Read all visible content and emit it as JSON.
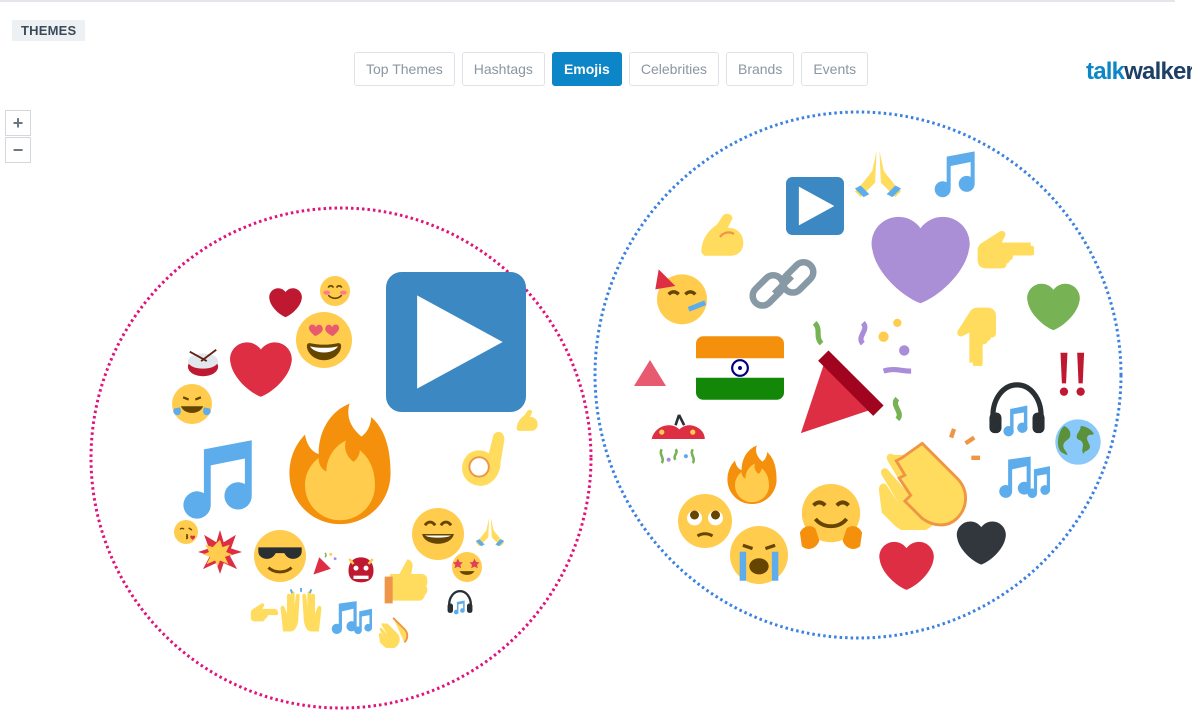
{
  "header": {
    "section_label": "THEMES",
    "brand": {
      "part1": "talk",
      "part2": "walker",
      "color1": "#0c86c6",
      "color2": "#1e3f66"
    }
  },
  "tabs": [
    {
      "label": "Top Themes",
      "active": false
    },
    {
      "label": "Hashtags",
      "active": false
    },
    {
      "label": "Emojis",
      "active": true
    },
    {
      "label": "Celebrities",
      "active": false
    },
    {
      "label": "Brands",
      "active": false
    },
    {
      "label": "Events",
      "active": false
    }
  ],
  "zoom": {
    "in_label": "+",
    "out_label": "−"
  },
  "clusters": [
    {
      "name": "left-cluster",
      "border_color": "#e0137c",
      "emojis": [
        "play-button",
        "fire",
        "musical-note",
        "heart",
        "red-heart-small",
        "heart-eyes-face",
        "smiling-blush-face",
        "drum",
        "tears-of-joy-face",
        "ok-hand",
        "flexed-biceps",
        "beaming-face",
        "folded-hands",
        "star-struck-face",
        "kissing-face",
        "collision",
        "sunglasses-face",
        "party-popper",
        "ogre",
        "thumbs-up",
        "pointing-right",
        "raising-hands",
        "musical-notes",
        "clapping-hands",
        "headphone"
      ]
    },
    {
      "name": "right-cluster",
      "border_color": "#3b82e0",
      "emojis": [
        "play-button",
        "folded-hands",
        "musical-note",
        "flexed-biceps",
        "purple-heart",
        "pointing-right",
        "partying-face",
        "link",
        "green-heart",
        "pointing-down",
        "triangle",
        "india-flag",
        "party-popper",
        "double-exclamation",
        "headphone",
        "confetti-ball",
        "globe",
        "fire",
        "musical-notes",
        "clapping-hands",
        "pleading-face",
        "smiling-face-hands",
        "crying-face",
        "red-heart",
        "black-heart"
      ]
    }
  ],
  "colors": {
    "active_tab": "#0c86c6",
    "left_cluster_border": "#e0137c",
    "right_cluster_border": "#3b82e0"
  }
}
